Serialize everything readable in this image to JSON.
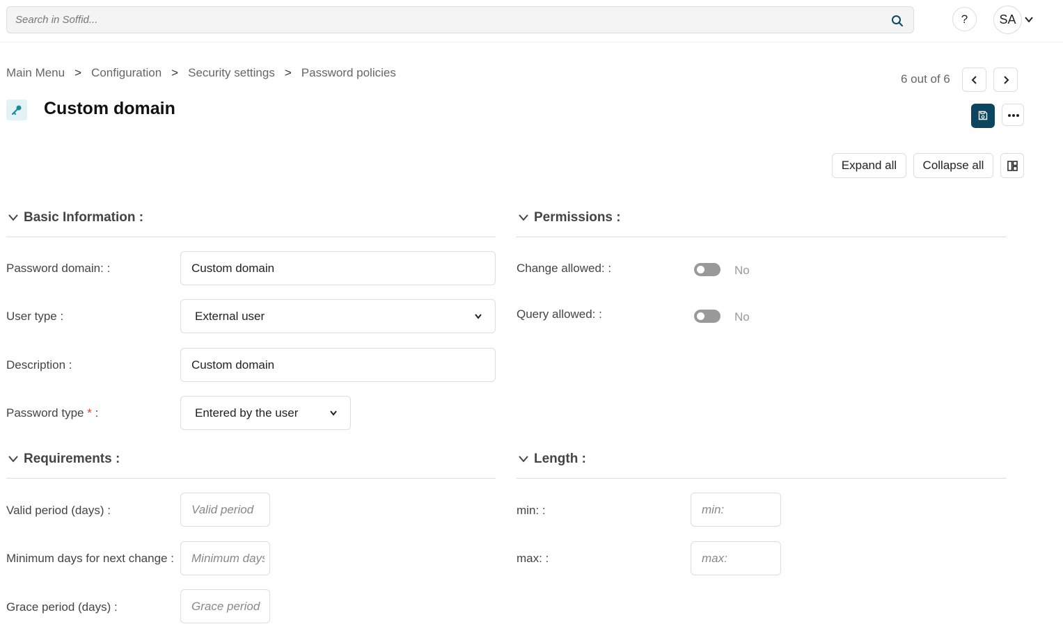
{
  "search": {
    "placeholder": "Search in Soffid..."
  },
  "header": {
    "help_label": "?",
    "user_initials": "SA"
  },
  "breadcrumb": [
    "Main Menu",
    "Configuration",
    "Security settings",
    "Password policies"
  ],
  "breadcrumb_separator": ">",
  "pager": {
    "text": "6 out of 6"
  },
  "page": {
    "title": "Custom domain"
  },
  "toolbar": {
    "expand_all": "Expand all",
    "collapse_all": "Collapse all"
  },
  "sections": {
    "basic": {
      "title": "Basic Information :",
      "password_domain_label": "Password domain: :",
      "password_domain_value": "Custom domain",
      "user_type_label": "User type :",
      "user_type_value": "External user",
      "description_label": "Description :",
      "description_value": "Custom domain",
      "password_type_label": "Password type",
      "password_type_required": "*",
      "password_type_suffix": ":",
      "password_type_value": "Entered by the user"
    },
    "permissions": {
      "title": "Permissions :",
      "change_allowed_label": "Change allowed: :",
      "change_allowed_value": "No",
      "query_allowed_label": "Query allowed: :",
      "query_allowed_value": "No"
    },
    "requirements": {
      "title": "Requirements :",
      "valid_period_label": "Valid period (days) :",
      "valid_period_placeholder": "Valid period",
      "min_days_label": "Minimum days for next change :",
      "min_days_placeholder": "Minimum days",
      "grace_period_label": "Grace period (days) :",
      "grace_period_placeholder": "Grace period"
    },
    "length": {
      "title": "Length :",
      "min_label": "min: :",
      "min_placeholder": "min:",
      "max_label": "max: :",
      "max_placeholder": "max:"
    }
  },
  "colors": {
    "primary": "#0b4560",
    "required": "#e53935",
    "icon_tint": "#1f8a9e"
  },
  "icons": {
    "search": "search-icon",
    "avatar_menu": "chevron-down-icon",
    "prev": "chevron-left-icon",
    "next": "chevron-right-icon",
    "title": "key-icon",
    "save": "save-icon",
    "more": "more-horizontal-icon",
    "layout": "layout-icon",
    "section": "chevron-down-icon"
  }
}
